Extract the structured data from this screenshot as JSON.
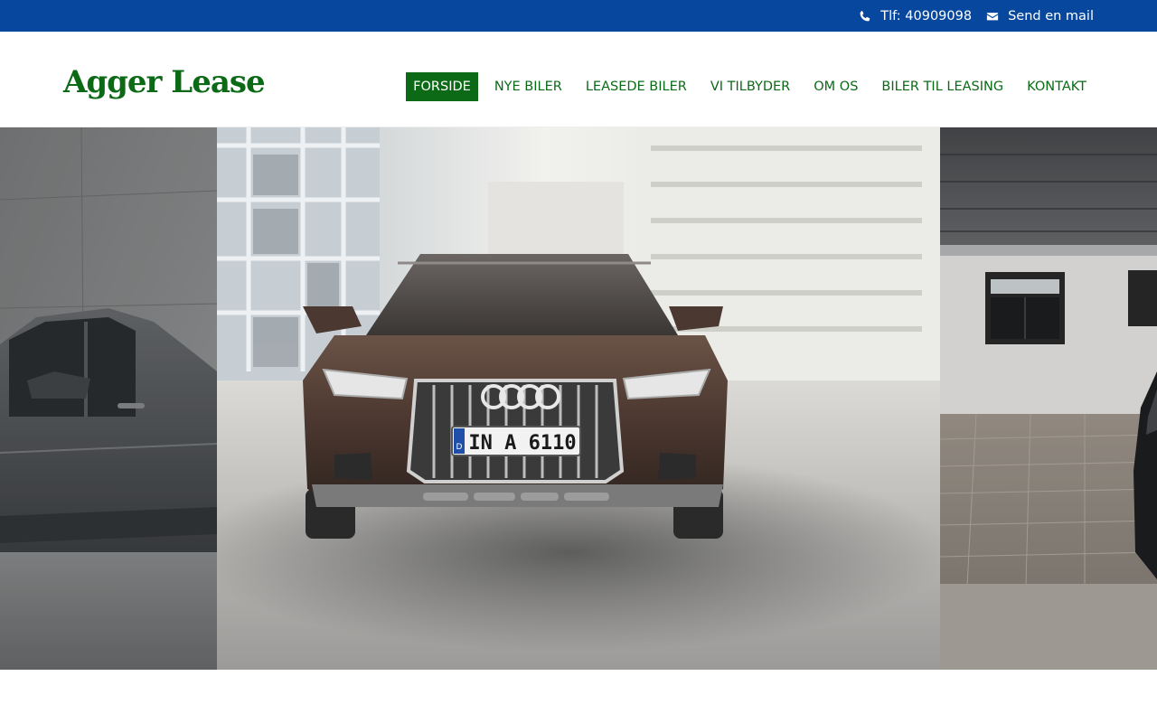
{
  "topbar": {
    "phone_label": "Tlf: 40909098",
    "mail_label": "Send en mail",
    "phone_icon": "phone-icon",
    "mail_icon": "envelope-icon"
  },
  "header": {
    "logo": "Agger Lease"
  },
  "nav": {
    "items": [
      {
        "label": "FORSIDE",
        "active": true
      },
      {
        "label": "NYE BILER"
      },
      {
        "label": "LEASEDE BILER"
      },
      {
        "label": "VI TILBYDER"
      },
      {
        "label": "OM OS"
      },
      {
        "label": "BILER TIL LEASING"
      },
      {
        "label": "KONTAKT"
      }
    ]
  },
  "hero": {
    "plate_text": "IN A 6110",
    "plate_country": "D"
  },
  "colors": {
    "topbar_bg": "#07479e",
    "brand_green": "#0c6a17",
    "white": "#ffffff"
  }
}
